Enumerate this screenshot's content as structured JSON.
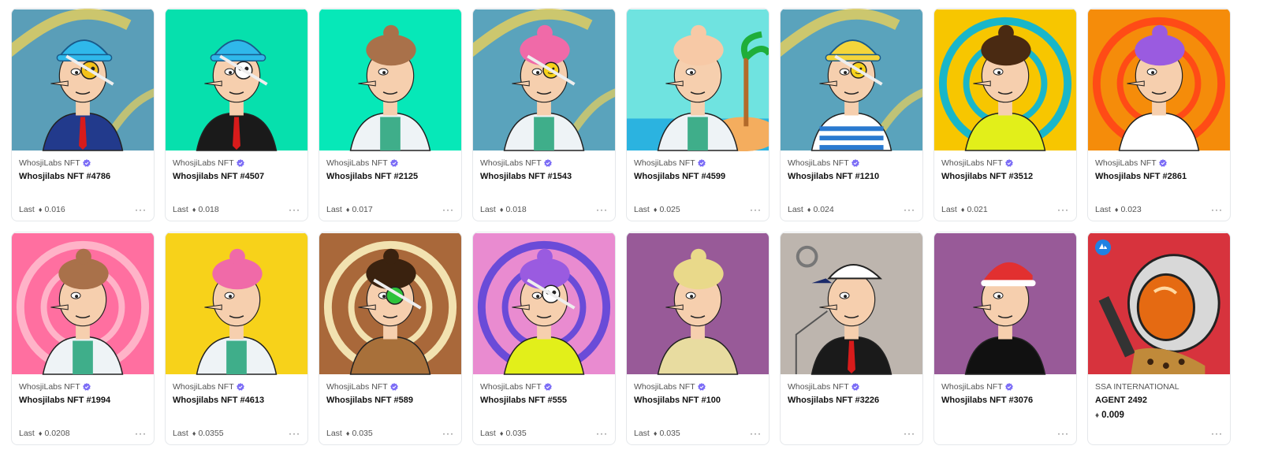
{
  "icons": {
    "verified": "verified-badge-icon",
    "eth": "ethereum-icon",
    "more": "more-options-icon",
    "chain": "chain-badge-icon"
  },
  "symbols": {
    "eth": "♦",
    "more": "···"
  },
  "cards": [
    {
      "collection": "WhosjiLabs NFT",
      "name": "Whosjilabs NFT #4786",
      "last_label": "Last",
      "price": "0.016",
      "verified": true,
      "bg": "#5a9eb8",
      "hair": "#2fb8ea",
      "hat": true,
      "patch": "yellow-skull",
      "shirt": "suit"
    },
    {
      "collection": "WhosjiLabs NFT",
      "name": "Whosjilabs NFT #4507",
      "last_label": "Last",
      "price": "0.018",
      "verified": true,
      "bg": "#06e0ad",
      "hair": "#2fb8ea",
      "hat": true,
      "patch": "skull",
      "shirt": "black"
    },
    {
      "collection": "WhosjiLabs NFT",
      "name": "Whosjilabs NFT #2125",
      "last_label": "Last",
      "price": "0.017",
      "verified": true,
      "bg": "#06e8b8",
      "hair": "#a9714a",
      "hat": false,
      "patch": "none",
      "shirt": "labcoat"
    },
    {
      "collection": "WhosjiLabs NFT",
      "name": "Whosjilabs NFT #1543",
      "last_label": "Last",
      "price": "0.018",
      "verified": true,
      "bg": "#5aa3bc",
      "hair": "#f06aa8",
      "hat": false,
      "patch": "smiley",
      "shirt": "labcoat"
    },
    {
      "collection": "WhosjiLabs NFT",
      "name": "Whosjilabs NFT #4599",
      "last_label": "Last",
      "price": "0.025",
      "verified": true,
      "bg": "#6fe3e0",
      "hair": "#f7c9a6",
      "hat": false,
      "patch": "none",
      "shirt": "labcoat"
    },
    {
      "collection": "WhosjiLabs NFT",
      "name": "Whosjilabs NFT #1210",
      "last_label": "Last",
      "price": "0.024",
      "verified": true,
      "bg": "#5aa3bc",
      "hair": "#f4d53b",
      "hat": true,
      "patch": "smiley",
      "shirt": "stripes"
    },
    {
      "collection": "WhosjiLabs NFT",
      "name": "Whosjilabs NFT #3512",
      "last_label": "Last",
      "price": "0.021",
      "verified": true,
      "bg": "#f7c600",
      "hair": "#4a2a12",
      "hat": false,
      "patch": "none",
      "shirt": "lime"
    },
    {
      "collection": "WhosjiLabs NFT",
      "name": "Whosjilabs NFT #2861",
      "last_label": "Last",
      "price": "0.023",
      "verified": true,
      "bg": "#f58c0a",
      "hair": "#9a5be0",
      "hat": false,
      "patch": "none",
      "shirt": "white"
    },
    {
      "collection": "WhosjiLabs NFT",
      "name": "Whosjilabs NFT #1994",
      "last_label": "Last",
      "price": "0.0208",
      "verified": true,
      "bg": "#ff6fa0",
      "hair": "#a9714a",
      "hat": false,
      "patch": "none",
      "shirt": "labcoat"
    },
    {
      "collection": "WhosjiLabs NFT",
      "name": "Whosjilabs NFT #4613",
      "last_label": "Last",
      "price": "0.0355",
      "verified": true,
      "bg": "#f7d21a",
      "hair": "#f06aa8",
      "hat": false,
      "patch": "none",
      "shirt": "labcoat"
    },
    {
      "collection": "WhosjiLabs NFT",
      "name": "Whosjilabs NFT #589",
      "last_label": "Last",
      "price": "0.035",
      "verified": true,
      "bg": "#a9683a",
      "hair": "#3a220f",
      "hat": false,
      "patch": "green",
      "shirt": "brown"
    },
    {
      "collection": "WhosjiLabs NFT",
      "name": "Whosjilabs NFT #555",
      "last_label": "Last",
      "price": "0.035",
      "verified": true,
      "bg": "#e98bd0",
      "hair": "#9a5be0",
      "hat": false,
      "patch": "skull",
      "shirt": "lime"
    },
    {
      "collection": "WhosjiLabs NFT",
      "name": "Whosjilabs NFT #100",
      "last_label": "Last",
      "price": "0.035",
      "verified": true,
      "bg": "#985a98",
      "hair": "#e9d98a",
      "hat": false,
      "patch": "none",
      "shirt": "beige"
    },
    {
      "collection": "WhosjiLabs NFT",
      "name": "Whosjilabs NFT #3226",
      "last_label": "",
      "price": "",
      "verified": true,
      "bg": "#bdb5ae",
      "hair": "#222222",
      "hat": true,
      "patch": "none",
      "shirt": "black"
    },
    {
      "collection": "WhosjiLabs NFT",
      "name": "Whosjilabs NFT #3076",
      "last_label": "",
      "price": "",
      "verified": true,
      "bg": "#985a98",
      "hair": "#e23030",
      "hat": true,
      "patch": "none",
      "shirt": "tank"
    },
    {
      "collection": "SSA INTERNATIONAL",
      "name": "AGENT 2492",
      "last_label": "",
      "price": "",
      "big_price": "0.009",
      "verified": false,
      "bg": "#d7333d",
      "hair": "#e66a1a",
      "hat": false,
      "patch": "none",
      "shirt": "helmet"
    }
  ]
}
